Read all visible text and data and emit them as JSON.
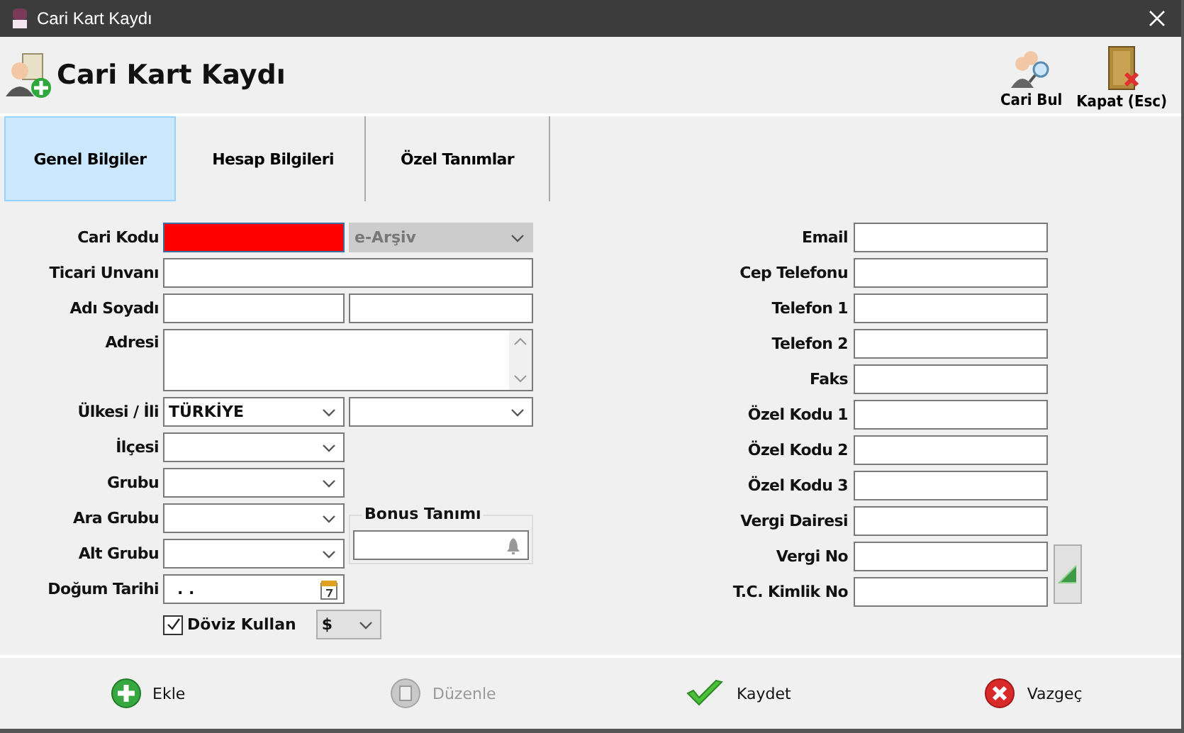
{
  "window": {
    "title": "Cari Kart Kaydı"
  },
  "header": {
    "title": "Cari Kart Kaydı",
    "tools": [
      {
        "label": "Cari Bul",
        "kind": "find"
      },
      {
        "label": "Kapat (Esc)",
        "kind": "exit"
      }
    ]
  },
  "tabs": [
    {
      "label": "Genel Bilgiler",
      "selected": true
    },
    {
      "label": "Hesap Bilgileri",
      "selected": false
    },
    {
      "label": "Özel Tanımlar",
      "selected": false
    }
  ],
  "left_fields": [
    {
      "label": "Cari Kodu",
      "controls": [
        {
          "kind": "text",
          "invalid": true
        },
        {
          "kind": "combo",
          "value": "e-Arşiv",
          "disabled": true
        }
      ]
    },
    {
      "label": "Ticari Unvanı",
      "controls": [
        {
          "kind": "text"
        }
      ]
    },
    {
      "label": "Adı Soyadı",
      "controls": [
        {
          "kind": "text"
        },
        {
          "kind": "text"
        }
      ]
    },
    {
      "label": "Adresi",
      "controls": [
        {
          "kind": "memo"
        }
      ]
    },
    {
      "label": "Ülkesi / İli",
      "controls": [
        {
          "kind": "combo",
          "value": "TÜRKİYE"
        },
        {
          "kind": "combo"
        }
      ]
    },
    {
      "label": "İlçesi",
      "controls": [
        {
          "kind": "combo"
        }
      ]
    },
    {
      "label": "Grubu",
      "controls": [
        {
          "kind": "combo"
        }
      ]
    },
    {
      "label": "Ara Grubu",
      "controls": [
        {
          "kind": "combo"
        }
      ]
    },
    {
      "label": "Alt Grubu",
      "controls": [
        {
          "kind": "combo"
        }
      ]
    },
    {
      "label": "Doğum Tarihi",
      "controls": [
        {
          "kind": "date",
          "value": ". ."
        }
      ]
    }
  ],
  "bonus": {
    "legend": "Bonus Tanımı"
  },
  "currency": {
    "label": "Döviz Kullan",
    "checked": true,
    "value": "$"
  },
  "right_fields": [
    {
      "label": "Email"
    },
    {
      "label": "Cep Telefonu"
    },
    {
      "label": "Telefon 1"
    },
    {
      "label": "Telefon 2"
    },
    {
      "label": "Faks"
    },
    {
      "label": "Özel Kodu 1"
    },
    {
      "label": "Özel Kodu 2"
    },
    {
      "label": "Özel Kodu 3"
    },
    {
      "label": "Vergi Dairesi"
    },
    {
      "label": "Vergi No"
    },
    {
      "label": "T.C. Kimlik No"
    }
  ],
  "footer_buttons": [
    {
      "label": "Ekle",
      "kind": "add",
      "disabled": false
    },
    {
      "label": "Düzenle",
      "kind": "edit",
      "disabled": true
    },
    {
      "label": "Kaydet",
      "kind": "save",
      "disabled": false
    },
    {
      "label": "Vazgeç",
      "kind": "cancel",
      "disabled": false
    }
  ]
}
